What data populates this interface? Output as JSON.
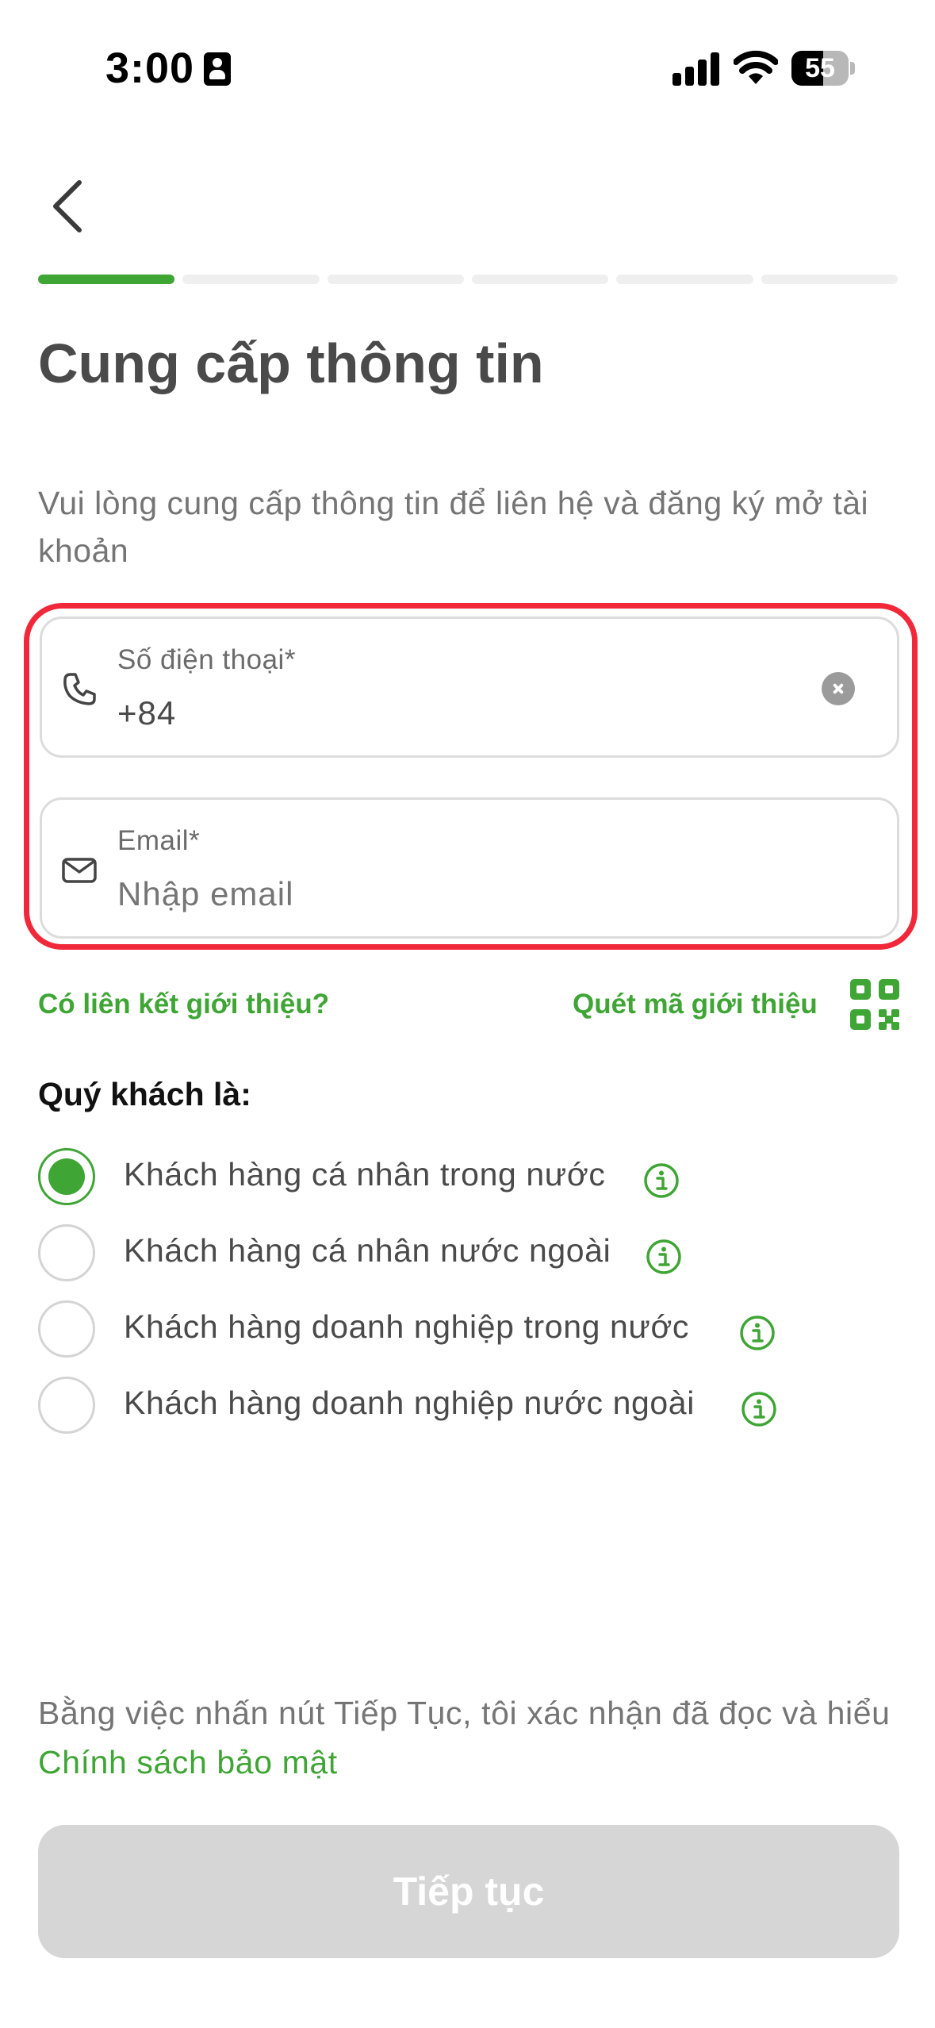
{
  "status_bar": {
    "time": "3:00",
    "battery_level": "55",
    "battery_fraction": 0.55
  },
  "header": {
    "back_icon": "chevron-left-icon",
    "progress": {
      "total_steps": 6,
      "current_step": 1
    }
  },
  "page": {
    "title": "Cung cấp thông tin",
    "subtitle": "Vui lòng cung cấp thông tin để liên hệ và đăng ký mở tài khoản"
  },
  "form": {
    "phone": {
      "label": "Số điện thoại*",
      "value": "+84",
      "icon": "phone-icon"
    },
    "email": {
      "label": "Email*",
      "placeholder": "Nhập email",
      "value": "",
      "icon": "mail-icon"
    }
  },
  "referral": {
    "link_label": "Có liên kết giới thiệu?",
    "scan_label": "Quét mã giới thiệu",
    "scan_icon": "qr-code-icon"
  },
  "customer_type": {
    "label": "Quý khách là:",
    "options": [
      {
        "label": "Khách hàng cá nhân trong nước",
        "selected": true
      },
      {
        "label": "Khách hàng cá nhân nước ngoài",
        "selected": false
      },
      {
        "label": "Khách hàng doanh nghiệp trong nước",
        "selected": false
      },
      {
        "label": "Khách hàng doanh nghiệp nước ngoài",
        "selected": false
      }
    ]
  },
  "footer": {
    "consent_text": "Bằng việc nhấn nút Tiếp Tục, tôi xác nhận đã đọc và hiểu ",
    "policy_link": "Chính sách bảo mật",
    "continue_label": "Tiếp tục"
  },
  "colors": {
    "accent": "#3fa535",
    "highlight": "#f0283a",
    "disabled_button": "#d6d6d6"
  }
}
